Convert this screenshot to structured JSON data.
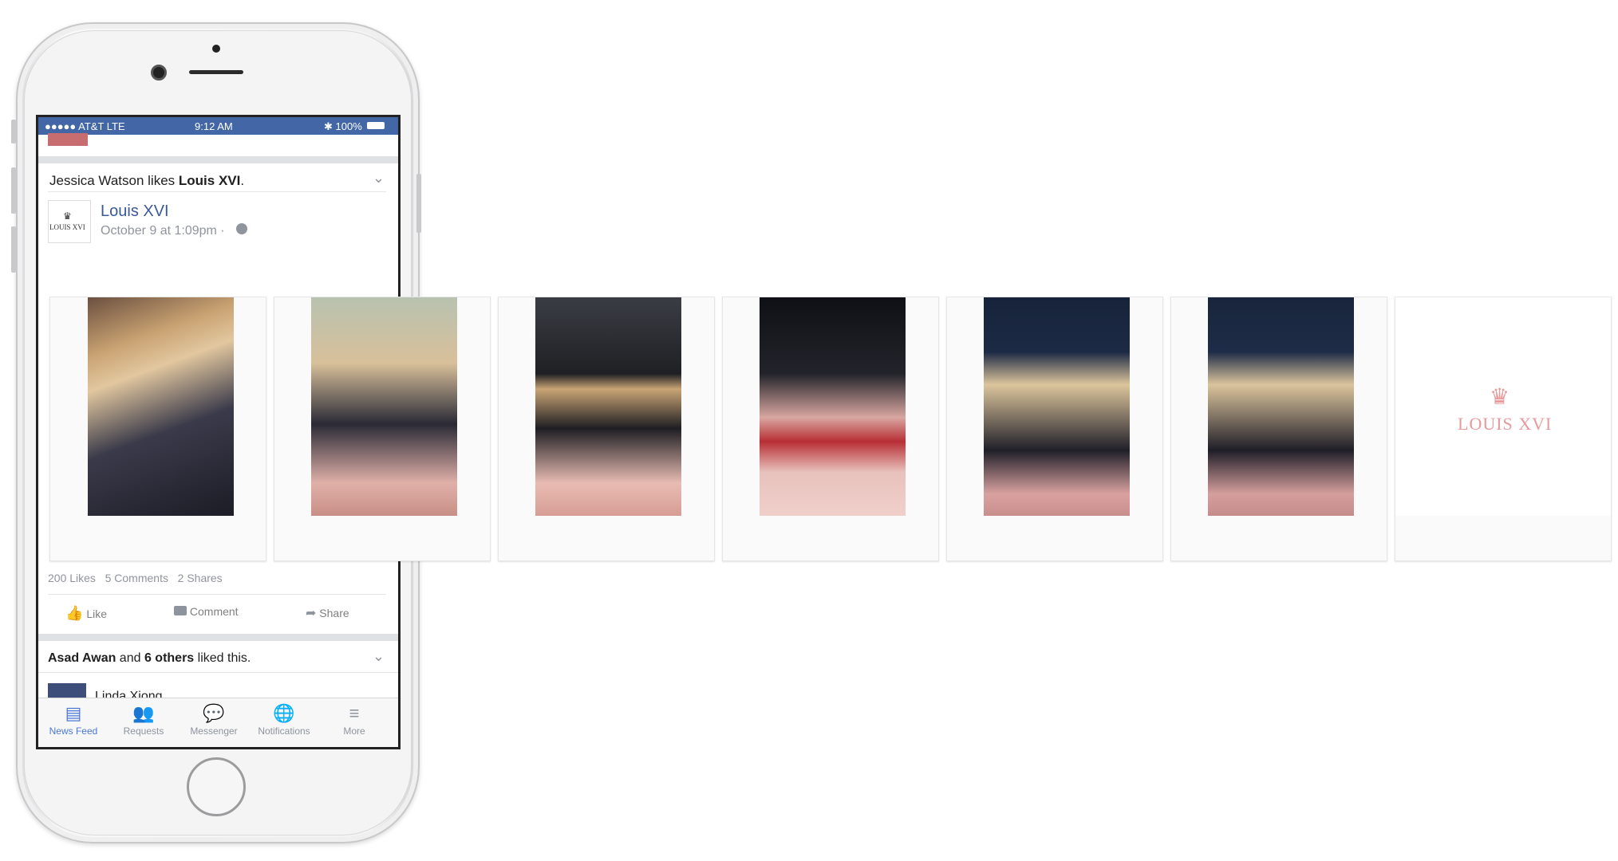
{
  "status_bar": {
    "carrier": "●●●●● AT&T  LTE",
    "time": "9:12 AM",
    "battery": "✱ 100%"
  },
  "story": {
    "context_name": "Jessica Watson",
    "context_verb": " likes ",
    "context_page": "Louis XVI",
    "context_end": ".",
    "page_name": "Louis XVI",
    "timestamp": "October 9 at 1:09pm ·",
    "logo_text": "LOUIS XVI",
    "stats": {
      "likes": "200 Likes",
      "comments": "5 Comments",
      "shares": "2 Shares"
    },
    "actions": {
      "like": "Like",
      "comment": "Comment",
      "share": "Share"
    }
  },
  "next_story": {
    "bold1": "Asad Awan",
    "mid": " and ",
    "bold2": "6 others",
    "end": " liked this.",
    "author": "Linda Xiong"
  },
  "carousel": {
    "brand_text": "LOUIS XVI"
  },
  "tabbar": [
    {
      "label": "News Feed",
      "icon": "news-feed-icon"
    },
    {
      "label": "Requests",
      "icon": "requests-icon"
    },
    {
      "label": "Messenger",
      "icon": "messenger-icon"
    },
    {
      "label": "Notifications",
      "icon": "notifications-icon"
    },
    {
      "label": "More",
      "icon": "more-icon"
    }
  ],
  "colors": {
    "facebook_blue": "#4266a6",
    "link_blue": "#3b5998",
    "brand_pink": "#e79a9b",
    "active_tab": "#4a78d6"
  }
}
